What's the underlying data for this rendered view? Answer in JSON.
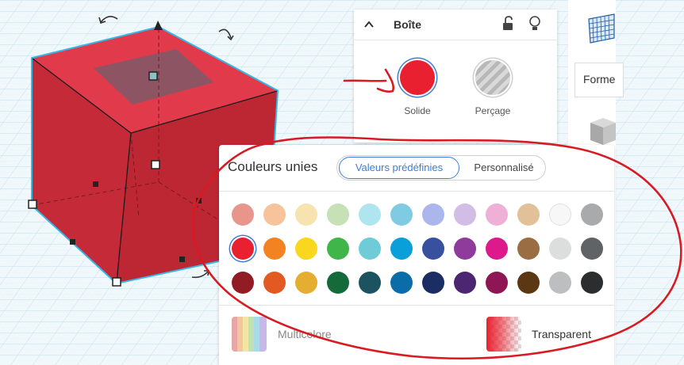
{
  "shape_panel": {
    "title": "Boîte",
    "collapse_icon": "chevron-up-icon",
    "lock_icon": "unlocked-padlock-icon",
    "bulb_icon": "lightbulb-icon",
    "solid_label": "Solide",
    "hole_label": "Perçage",
    "solid_color": "#e8202f",
    "selected": "Solide"
  },
  "right_panel": {
    "formes_label": "Forme"
  },
  "color_panel": {
    "title": "Couleurs unies",
    "tabs": [
      "Valeurs prédéfinies",
      "Personnalisé"
    ],
    "active_tab": "Valeurs prédéfinies",
    "swatches": [
      [
        "#e8968b",
        "#f6c39a",
        "#f6e3b0",
        "#c6e1b6",
        "#aee5ee",
        "#7ecbe3",
        "#aab6ec",
        "#d2bde6",
        "#eeb0d6",
        "#e2c098",
        "#f7f7f7",
        "#a8aaab"
      ],
      [
        "#e8202f",
        "#f28222",
        "#f9d71e",
        "#3fb54a",
        "#6fcbd8",
        "#0a9fd8",
        "#37519f",
        "#8e3b9b",
        "#dd1a8c",
        "#9a6d43",
        "#dcdddd",
        "#606366"
      ],
      [
        "#921c24",
        "#e25a21",
        "#e5ae31",
        "#146a38",
        "#1d5361",
        "#0a6da8",
        "#1b2d62",
        "#4c2670",
        "#8e1654",
        "#5b3714",
        "#bcbec0",
        "#2c2d2e"
      ]
    ],
    "selected_swatch": "#e8202f",
    "multicolor_label": "Multicolore",
    "transparent_label": "Transparent"
  },
  "colors": {
    "accent": "#3d7dd6",
    "box_red": "#d32d3d",
    "selection_outline": "#33b8e8",
    "annotation_red": "#d81b23"
  }
}
